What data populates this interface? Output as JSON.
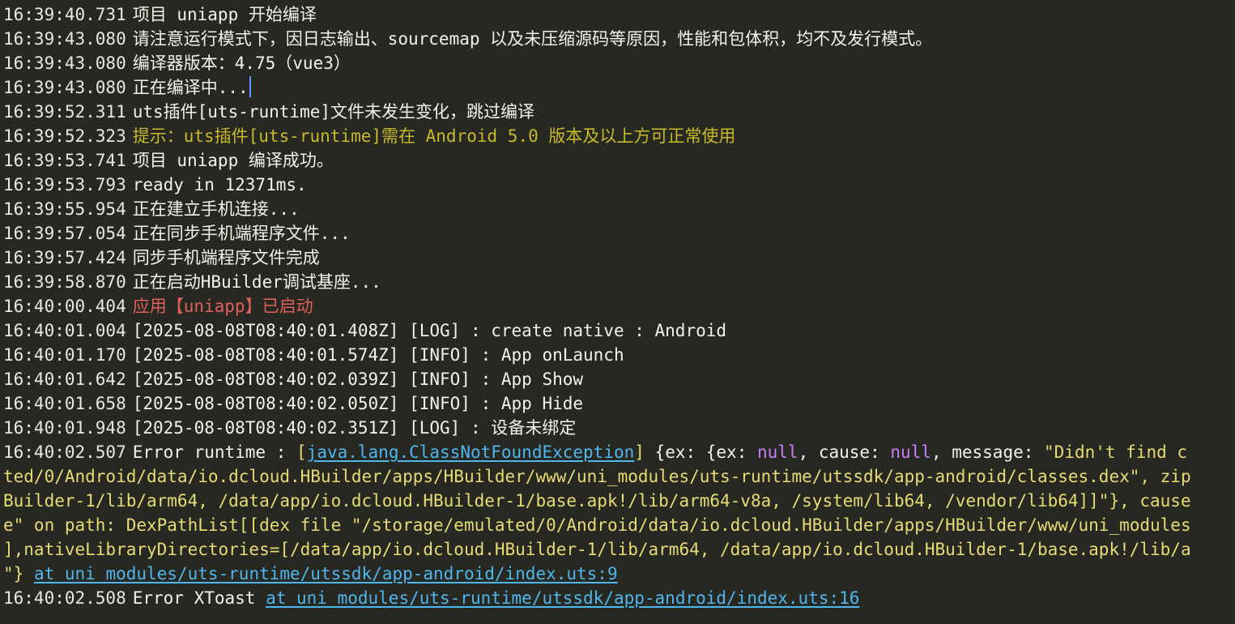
{
  "colors": {
    "background": "#272822",
    "text": "#f2f2ea",
    "warning": "#c8b92c",
    "app_started": "#e0605a",
    "link": "#4fb6ee",
    "keyword": "#c77dfc",
    "string": "#e6db74"
  },
  "lines": [
    {
      "ts": "16:39:40.731",
      "msg": "项目 uniapp 开始编译"
    },
    {
      "ts": "16:39:43.080",
      "msg": "请注意运行模式下，因日志输出、sourcemap 以及未压缩源码等原因，性能和包体积，均不及发行模式。"
    },
    {
      "ts": "16:39:43.080",
      "msg": "编译器版本：4.75（vue3）"
    },
    {
      "ts": "16:39:43.080",
      "msg": "正在编译中..."
    },
    {
      "ts": "16:39:52.311",
      "msg": "uts插件[uts-runtime]文件未发生变化，跳过编译"
    },
    {
      "ts": "16:39:52.323",
      "msg": "提示：uts插件[uts-runtime]需在 Android 5.0 版本及以上方可正常使用"
    },
    {
      "ts": "16:39:53.741",
      "msg": "项目 uniapp 编译成功。"
    },
    {
      "ts": "16:39:53.793",
      "msg": "ready in 12371ms."
    },
    {
      "ts": "16:39:55.954",
      "msg": "正在建立手机连接..."
    },
    {
      "ts": "16:39:57.054",
      "msg": "正在同步手机端程序文件..."
    },
    {
      "ts": "16:39:57.424",
      "msg": "同步手机端程序文件完成"
    },
    {
      "ts": "16:39:58.870",
      "msg": "正在启动HBuilder调试基座..."
    },
    {
      "ts": "16:40:00.404",
      "msg": "应用【uniapp】已启动"
    },
    {
      "ts": "16:40:01.004",
      "msg": "[2025-08-08T08:40:01.408Z] [LOG] : create native : Android"
    },
    {
      "ts": "16:40:01.170",
      "msg": "[2025-08-08T08:40:01.574Z] [INFO] : App onLaunch"
    },
    {
      "ts": "16:40:01.642",
      "msg": "[2025-08-08T08:40:02.039Z] [INFO] : App Show"
    },
    {
      "ts": "16:40:01.658",
      "msg": "[2025-08-08T08:40:02.050Z] [INFO] : App Hide"
    },
    {
      "ts": "16:40:01.948",
      "msg": "[2025-08-08T08:40:02.351Z] [LOG] : 设备未绑定"
    }
  ],
  "error1": {
    "ts": "16:40:02.507",
    "prefix": "Error runtime : ",
    "open_bracket": "[",
    "exception": "java.lang.ClassNotFoundException",
    "close_bracket": "]",
    "obj_start": " {ex: {ex: ",
    "null1": "null",
    "cause_label": ", cause: ",
    "null2": "null",
    "message_label": ", message: ",
    "message_start": "\"Didn't find c",
    "wrap1": "ted/0/Android/data/io.dcloud.HBuilder/apps/HBuilder/www/uni_modules/uts-runtime/utssdk/app-android/classes.dex\", zip",
    "wrap2": "Builder-1/lib/arm64, /data/app/io.dcloud.HBuilder-1/base.apk!/lib/arm64-v8a, /system/lib64, /vendor/lib64]]\"}, cause",
    "wrap3": "e\" on path: DexPathList[[dex file \"/storage/emulated/0/Android/data/io.dcloud.HBuilder/apps/HBuilder/www/uni_modules",
    "wrap4": "],nativeLibraryDirectories=[/data/app/io.dcloud.HBuilder-1/lib/arm64, /data/app/io.dcloud.HBuilder-1/base.apk!/lib/a",
    "wrap5_start": "\"} ",
    "wrap5_link": "at uni_modules/uts-runtime/utssdk/app-android/index.uts:9"
  },
  "error2": {
    "ts": "16:40:02.508",
    "prefix": "Error XToast ",
    "link": "at uni_modules/uts-runtime/utssdk/app-android/index.uts:16"
  }
}
